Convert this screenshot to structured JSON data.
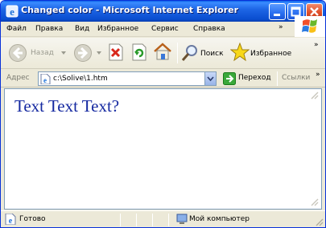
{
  "window": {
    "title": "Changed color - Microsoft Internet Explorer"
  },
  "menu": {
    "items": [
      "Файл",
      "Правка",
      "Вид",
      "Избранное",
      "Сервис",
      "Справка"
    ],
    "overflow": "»"
  },
  "toolbar": {
    "back_label": "Назад",
    "search_label": "Поиск",
    "favorites_label": "Избранное",
    "overflow": "»"
  },
  "address": {
    "label": "Адрес",
    "value": "c:\\Solive\\1.htm",
    "go_label": "Переход",
    "links_label": "Ссылки",
    "overflow": "»"
  },
  "page": {
    "text": "Text Text Text?",
    "text_color": "#1428a0"
  },
  "status": {
    "text": "Готово",
    "zone": "Мой компьютер"
  },
  "colors": {
    "title_bar": "#0a4ed0",
    "window_bg": "#ece9d8",
    "close_button": "#e0502a"
  }
}
